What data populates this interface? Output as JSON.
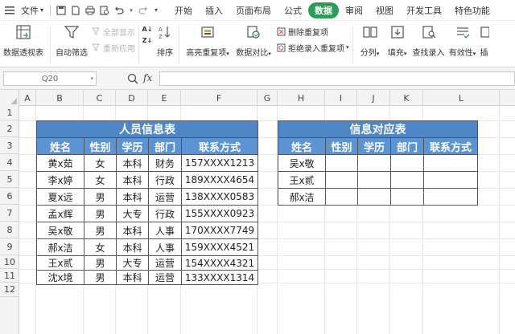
{
  "menubar": {
    "file_label": "文件",
    "tabs": [
      "开始",
      "插入",
      "页面布局",
      "公式",
      "数据",
      "审阅",
      "视图",
      "开发工具",
      "特色功能"
    ],
    "active_tab": "数据"
  },
  "ribbon": {
    "pivot_table": "数据透视表",
    "auto_filter": "自动筛选",
    "show_all": "全部显示",
    "reapply": "重新应用",
    "sort": "排序",
    "highlight_dup": "高亮重复项",
    "data_compare": "数据对比",
    "remove_dup": "删除重复项",
    "reject_dup": "拒绝录入重复项",
    "split_columns": "分列",
    "fill": "填充",
    "lookup_entry": "查找录入",
    "validity": "有效性",
    "extra": "插"
  },
  "formula_bar": {
    "cell_ref": "Q20",
    "fx": "fx",
    "content": ""
  },
  "grid": {
    "columns": [
      "A",
      "B",
      "C",
      "D",
      "E",
      "F",
      "G",
      "H",
      "I",
      "J",
      "K",
      "L"
    ],
    "rows": [
      "1",
      "2",
      "3",
      "4",
      "5",
      "6",
      "7",
      "8",
      "9",
      "10",
      "11",
      "12"
    ]
  },
  "table1": {
    "title": "人员信息表",
    "headers": [
      "姓名",
      "性别",
      "学历",
      "部门",
      "联系方式"
    ],
    "rows": [
      [
        "黄x茹",
        "女",
        "本科",
        "财务",
        "157XXXX1213"
      ],
      [
        "李x婷",
        "女",
        "本科",
        "行政",
        "189XXXX4654"
      ],
      [
        "夏x远",
        "男",
        "本科",
        "运营",
        "138XXXX0583"
      ],
      [
        "孟x辉",
        "男",
        "大专",
        "行政",
        "155XXXX0923"
      ],
      [
        "吴x敬",
        "男",
        "本科",
        "人事",
        "170XXXX7749"
      ],
      [
        "郝x洁",
        "女",
        "本科",
        "人事",
        "159XXXX4521"
      ],
      [
        "王x贰",
        "男",
        "大专",
        "运营",
        "154XXXX4321"
      ],
      [
        "沈x境",
        "男",
        "本科",
        "运营",
        "133XXXX1314"
      ]
    ]
  },
  "table2": {
    "title": "信息对应表",
    "headers": [
      "姓名",
      "性别",
      "学历",
      "部门",
      "联系方式"
    ],
    "rows": [
      [
        "吴x敬",
        "",
        "",
        "",
        ""
      ],
      [
        "王x贰",
        "",
        "",
        "",
        ""
      ],
      [
        "郝x洁",
        "",
        "",
        "",
        ""
      ]
    ]
  }
}
